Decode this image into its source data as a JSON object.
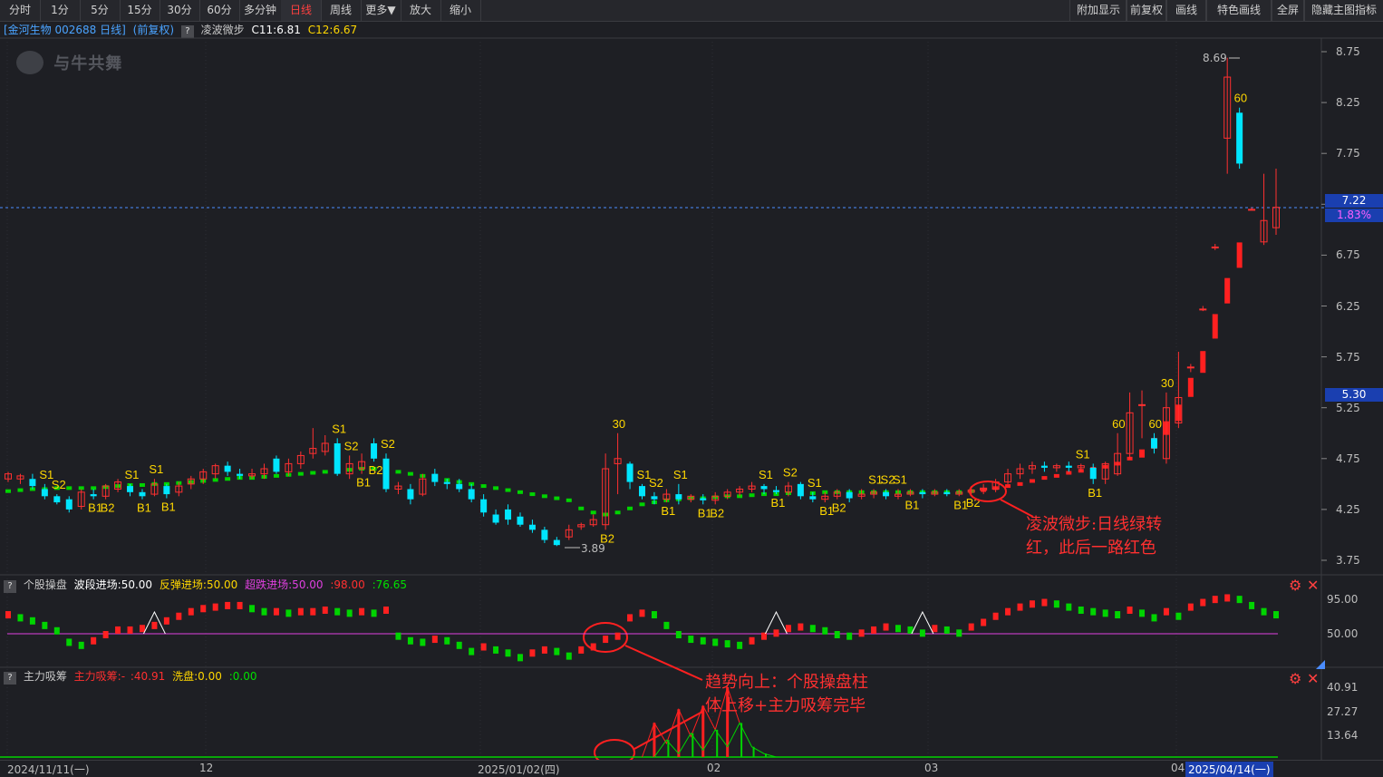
{
  "toolbar": {
    "left": [
      "分时",
      "1分",
      "5分",
      "15分",
      "30分",
      "60分",
      "多分钟",
      "日线",
      "周线",
      "更多▼",
      "放大",
      "缩小"
    ],
    "active": "日线",
    "right": [
      "附加显示",
      "前复权",
      "画线",
      "特色画线",
      "全屏",
      "隐藏主图指标"
    ]
  },
  "header": {
    "stock": "[金河生物 002688 日线]",
    "adjust": "(前复权)",
    "q": "?",
    "indicator": "凌波微步",
    "c11": "C11:6.81",
    "c12": "C12:6.67"
  },
  "watermark": "与牛共舞",
  "price_axis": [
    "8.75",
    "8.25",
    "7.75",
    "7.25",
    "6.75",
    "6.25",
    "5.75",
    "5.25",
    "4.75",
    "4.25",
    "3.75"
  ],
  "price_tags": {
    "last": "7.22",
    "pct": "1.83%",
    "line": "5.30"
  },
  "annotations": {
    "high": "8.69",
    "low": "3.89",
    "note1_line1": "凌波微步:日线绿转",
    "note1_line2": "红，此后一路红色",
    "note2_line1": "趋势向上：个股操盘柱",
    "note2_line2": "体上移+主力吸筹完毕"
  },
  "pane2": {
    "q": "?",
    "name": "个股操盘",
    "l1": "波段进场:50.00",
    "l2": "反弹进场:50.00",
    "l3": "超跌进场:50.00",
    "l4": ":98.00",
    "l5": ":76.65",
    "axis": [
      "95.00",
      "50.00"
    ]
  },
  "pane3": {
    "q": "?",
    "name": "主力吸筹",
    "l1": "主力吸筹:-",
    "l2": ":40.91",
    "l3": "洗盘:0.00",
    "l4": ":0.00",
    "axis": [
      "40.91",
      "27.27",
      "13.64"
    ]
  },
  "date_axis": [
    "2024/11/11(一)",
    "12",
    "2025/01/02(四)",
    "02",
    "03",
    "04",
    "2025/04/14(一)"
  ],
  "colors": {
    "up": "#ff3030",
    "down": "#00e5ff",
    "green": "#00d400",
    "red": "#ff2020",
    "yellow": "#ffd700",
    "magenta": "#e040e0",
    "bg": "#1e1f24"
  },
  "chart_data": {
    "type": "candlestick",
    "ylim": [
      3.6,
      8.95
    ],
    "candles": [
      [
        4.55,
        4.6,
        4.52,
        4.62
      ],
      [
        4.55,
        4.58,
        4.5,
        4.6
      ],
      [
        4.55,
        4.48,
        4.45,
        4.6
      ],
      [
        4.45,
        4.38,
        4.35,
        4.5
      ],
      [
        4.38,
        4.32,
        4.3,
        4.4
      ],
      [
        4.35,
        4.25,
        4.22,
        4.38
      ],
      [
        4.28,
        4.42,
        4.25,
        4.45
      ],
      [
        4.4,
        4.38,
        4.35,
        4.45
      ],
      [
        4.38,
        4.48,
        4.35,
        4.5
      ],
      [
        4.45,
        4.52,
        4.42,
        4.55
      ],
      [
        4.48,
        4.42,
        4.38,
        4.5
      ],
      [
        4.42,
        4.38,
        4.35,
        4.45
      ],
      [
        4.4,
        4.5,
        4.38,
        4.55
      ],
      [
        4.48,
        4.4,
        4.36,
        4.5
      ],
      [
        4.42,
        4.48,
        4.38,
        4.52
      ],
      [
        4.5,
        4.55,
        4.45,
        4.58
      ],
      [
        4.55,
        4.62,
        4.5,
        4.65
      ],
      [
        4.6,
        4.68,
        4.55,
        4.7
      ],
      [
        4.68,
        4.62,
        4.58,
        4.72
      ],
      [
        4.6,
        4.58,
        4.55,
        4.65
      ],
      [
        4.58,
        4.6,
        4.55,
        4.65
      ],
      [
        4.6,
        4.65,
        4.55,
        4.7
      ],
      [
        4.75,
        4.62,
        4.6,
        4.78
      ],
      [
        4.62,
        4.7,
        4.58,
        4.75
      ],
      [
        4.7,
        4.78,
        4.65,
        4.82
      ],
      [
        4.8,
        4.85,
        4.75,
        5.05
      ],
      [
        4.82,
        4.9,
        4.78,
        4.98
      ],
      [
        4.9,
        4.6,
        4.58,
        4.95
      ],
      [
        4.6,
        4.7,
        4.55,
        4.78
      ],
      [
        4.65,
        4.72,
        4.6,
        4.8
      ],
      [
        4.9,
        4.75,
        4.72,
        4.95
      ],
      [
        4.75,
        4.45,
        4.42,
        4.8
      ],
      [
        4.45,
        4.48,
        4.4,
        4.52
      ],
      [
        4.45,
        4.35,
        4.3,
        4.5
      ],
      [
        4.4,
        4.55,
        4.38,
        4.6
      ],
      [
        4.6,
        4.52,
        4.48,
        4.65
      ],
      [
        4.52,
        4.5,
        4.45,
        4.55
      ],
      [
        4.5,
        4.45,
        4.42,
        4.55
      ],
      [
        4.45,
        4.35,
        4.32,
        4.5
      ],
      [
        4.35,
        4.22,
        4.18,
        4.4
      ],
      [
        4.2,
        4.12,
        4.1,
        4.25
      ],
      [
        4.25,
        4.15,
        4.1,
        4.3
      ],
      [
        4.18,
        4.1,
        4.08,
        4.22
      ],
      [
        4.1,
        4.05,
        4.02,
        4.15
      ],
      [
        4.05,
        3.95,
        3.92,
        4.08
      ],
      [
        3.95,
        3.9,
        3.89,
        3.98
      ],
      [
        3.98,
        4.05,
        3.95,
        4.1
      ],
      [
        4.08,
        4.1,
        4.05,
        4.12
      ],
      [
        4.1,
        4.15,
        4.08,
        4.2
      ],
      [
        4.1,
        4.65,
        4.05,
        4.8
      ],
      [
        4.7,
        4.75,
        4.4,
        5.0
      ],
      [
        4.7,
        4.52,
        4.45,
        4.72
      ],
      [
        4.48,
        4.38,
        4.35,
        4.5
      ],
      [
        4.38,
        4.35,
        4.3,
        4.42
      ],
      [
        4.35,
        4.4,
        4.32,
        4.45
      ],
      [
        4.4,
        4.35,
        4.3,
        4.5
      ],
      [
        4.35,
        4.38,
        4.32,
        4.4
      ],
      [
        4.36,
        4.34,
        4.3,
        4.4
      ],
      [
        4.34,
        4.38,
        4.3,
        4.42
      ],
      [
        4.38,
        4.42,
        4.35,
        4.45
      ],
      [
        4.42,
        4.45,
        4.38,
        4.48
      ],
      [
        4.45,
        4.48,
        4.42,
        4.52
      ],
      [
        4.48,
        4.45,
        4.4,
        4.5
      ],
      [
        4.44,
        4.42,
        4.4,
        4.48
      ],
      [
        4.42,
        4.48,
        4.38,
        4.52
      ],
      [
        4.5,
        4.38,
        4.35,
        4.52
      ],
      [
        4.38,
        4.35,
        4.32,
        4.42
      ],
      [
        4.35,
        4.38,
        4.32,
        4.42
      ],
      [
        4.38,
        4.42,
        4.35,
        4.45
      ],
      [
        4.42,
        4.36,
        4.32,
        4.45
      ],
      [
        4.38,
        4.4,
        4.35,
        4.45
      ],
      [
        4.4,
        4.42,
        4.36,
        4.45
      ],
      [
        4.42,
        4.38,
        4.35,
        4.45
      ],
      [
        4.38,
        4.4,
        4.35,
        4.45
      ],
      [
        4.4,
        4.42,
        4.38,
        4.45
      ],
      [
        4.42,
        4.4,
        4.36,
        4.45
      ],
      [
        4.4,
        4.42,
        4.38,
        4.45
      ],
      [
        4.42,
        4.4,
        4.38,
        4.45
      ],
      [
        4.4,
        4.42,
        4.38,
        4.45
      ],
      [
        4.42,
        4.44,
        4.4,
        4.48
      ],
      [
        4.44,
        4.46,
        4.4,
        4.5
      ],
      [
        4.45,
        4.52,
        4.42,
        4.55
      ],
      [
        4.52,
        4.6,
        4.5,
        4.65
      ],
      [
        4.6,
        4.65,
        4.55,
        4.7
      ],
      [
        4.65,
        4.68,
        4.6,
        4.72
      ],
      [
        4.68,
        4.66,
        4.62,
        4.72
      ],
      [
        4.66,
        4.68,
        4.62,
        4.7
      ],
      [
        4.68,
        4.66,
        4.62,
        4.72
      ],
      [
        4.66,
        4.68,
        4.62,
        4.7
      ],
      [
        4.66,
        4.55,
        4.5,
        4.7
      ],
      [
        4.55,
        4.7,
        4.5,
        4.72
      ],
      [
        4.6,
        4.8,
        4.58,
        5.0
      ],
      [
        4.8,
        5.2,
        4.75,
        5.4
      ],
      [
        5.28,
        5.28,
        4.95,
        5.42
      ],
      [
        4.95,
        4.85,
        4.8,
        5.0
      ],
      [
        4.75,
        5.25,
        4.7,
        5.4
      ],
      [
        5.1,
        5.35,
        5.05,
        5.8
      ],
      [
        5.65,
        5.65,
        5.6,
        5.68
      ],
      [
        6.22,
        6.22,
        6.2,
        6.25
      ],
      [
        6.83,
        6.83,
        6.8,
        6.86
      ],
      [
        7.9,
        8.5,
        7.55,
        8.69
      ],
      [
        8.15,
        7.65,
        7.6,
        8.2
      ],
      [
        7.2,
        7.2,
        7.2,
        7.22
      ],
      [
        6.88,
        7.09,
        6.85,
        7.55
      ],
      [
        7.02,
        7.22,
        6.95,
        7.6
      ]
    ],
    "tags": [
      {
        "i": 3,
        "t": "S1"
      },
      {
        "i": 4,
        "t": "S2"
      },
      {
        "i": 7,
        "t": "B1"
      },
      {
        "i": 8,
        "t": "B2"
      },
      {
        "i": 10,
        "t": "S1"
      },
      {
        "i": 11,
        "t": "B1"
      },
      {
        "i": 12,
        "t": "S1"
      },
      {
        "i": 13,
        "t": "B1"
      },
      {
        "i": 27,
        "t": "S1"
      },
      {
        "i": 28,
        "t": "S2"
      },
      {
        "i": 29,
        "t": "B1"
      },
      {
        "i": 30,
        "t": "B2"
      },
      {
        "i": 31,
        "t": "S2"
      },
      {
        "i": 49,
        "t": "B2"
      },
      {
        "i": 50,
        "t": "30"
      },
      {
        "i": 52,
        "t": "S1"
      },
      {
        "i": 53,
        "t": "S2"
      },
      {
        "i": 54,
        "t": "B1"
      },
      {
        "i": 55,
        "t": "S1"
      },
      {
        "i": 57,
        "t": "B1"
      },
      {
        "i": 58,
        "t": "B2"
      },
      {
        "i": 62,
        "t": "S1"
      },
      {
        "i": 63,
        "t": "B1"
      },
      {
        "i": 64,
        "t": "S2"
      },
      {
        "i": 66,
        "t": "S1"
      },
      {
        "i": 67,
        "t": "B1"
      },
      {
        "i": 68,
        "t": "B2"
      },
      {
        "i": 71,
        "t": "S1"
      },
      {
        "i": 72,
        "t": "S2"
      },
      {
        "i": 73,
        "t": "S1"
      },
      {
        "i": 74,
        "t": "B1"
      },
      {
        "i": 78,
        "t": "B1"
      },
      {
        "i": 79,
        "t": "B2"
      },
      {
        "i": 88,
        "t": "S1"
      },
      {
        "i": 89,
        "t": "B1"
      },
      {
        "i": 91,
        "t": "60"
      },
      {
        "i": 94,
        "t": "60"
      },
      {
        "i": 95,
        "t": "30"
      },
      {
        "i": 101,
        "t": "60"
      }
    ],
    "ma_line": [
      4.43,
      4.44,
      4.45,
      4.45,
      4.46,
      4.46,
      4.46,
      4.46,
      4.47,
      4.48,
      4.49,
      4.49,
      4.5,
      4.5,
      4.51,
      4.52,
      4.53,
      4.54,
      4.55,
      4.56,
      4.56,
      4.57,
      4.58,
      4.59,
      4.6,
      4.61,
      4.62,
      4.63,
      4.64,
      4.65,
      4.65,
      4.64,
      4.62,
      4.6,
      4.58,
      4.56,
      4.54,
      4.52,
      4.5,
      4.48,
      4.46,
      4.44,
      4.42,
      4.4,
      4.38,
      4.36,
      4.34,
      4.26,
      4.22,
      4.2,
      4.22,
      4.26,
      4.3,
      4.32,
      4.34,
      4.35,
      4.36,
      4.36,
      4.37,
      4.38,
      4.38,
      4.39,
      4.4,
      4.4,
      4.41,
      4.41,
      4.41,
      4.42,
      4.42,
      4.42,
      4.42,
      4.42,
      4.42,
      4.42,
      4.42,
      4.42,
      4.42,
      4.42,
      4.42,
      4.43,
      4.44,
      4.46,
      4.48,
      4.5,
      4.53,
      4.56,
      4.58,
      4.61,
      4.63,
      4.65,
      4.67,
      4.7,
      4.75,
      4.8,
      4.9,
      5.05,
      5.2,
      5.45,
      5.7,
      6.05,
      6.4,
      6.75
    ],
    "ma_green_until": 80,
    "pane2_values": [
      76,
      72,
      68,
      62,
      55,
      40,
      36,
      42,
      50,
      56,
      56,
      58,
      62,
      68,
      74,
      80,
      84,
      86,
      88,
      88,
      84,
      80,
      80,
      78,
      80,
      80,
      82,
      80,
      78,
      80,
      78,
      82,
      48,
      42,
      40,
      44,
      42,
      36,
      28,
      34,
      30,
      26,
      20,
      26,
      30,
      28,
      22,
      30,
      34,
      44,
      48,
      72,
      78,
      76,
      62,
      50,
      44,
      42,
      40,
      38,
      36,
      42,
      48,
      52,
      58,
      60,
      58,
      55,
      50,
      48,
      52,
      56,
      60,
      58,
      56,
      52,
      58,
      56,
      52,
      60,
      66,
      74,
      80,
      86,
      90,
      92,
      90,
      86,
      82,
      80,
      78,
      76,
      82,
      78,
      72,
      80,
      74,
      86,
      92,
      96,
      98,
      96,
      88,
      80,
      76
    ],
    "pane2_triangles": [
      12,
      63,
      75
    ],
    "pane3_bars": [
      {
        "i": 53,
        "v": 20
      },
      {
        "i": 55,
        "v": 28
      },
      {
        "i": 57,
        "v": 30
      },
      {
        "i": 59,
        "v": 40.91
      }
    ],
    "pane3_green": [
      {
        "i": 54,
        "v": 10
      },
      {
        "i": 56,
        "v": 14
      },
      {
        "i": 58,
        "v": 16
      },
      {
        "i": 60,
        "v": 20
      },
      {
        "i": 61,
        "v": 6
      },
      {
        "i": 62,
        "v": 2
      }
    ]
  }
}
